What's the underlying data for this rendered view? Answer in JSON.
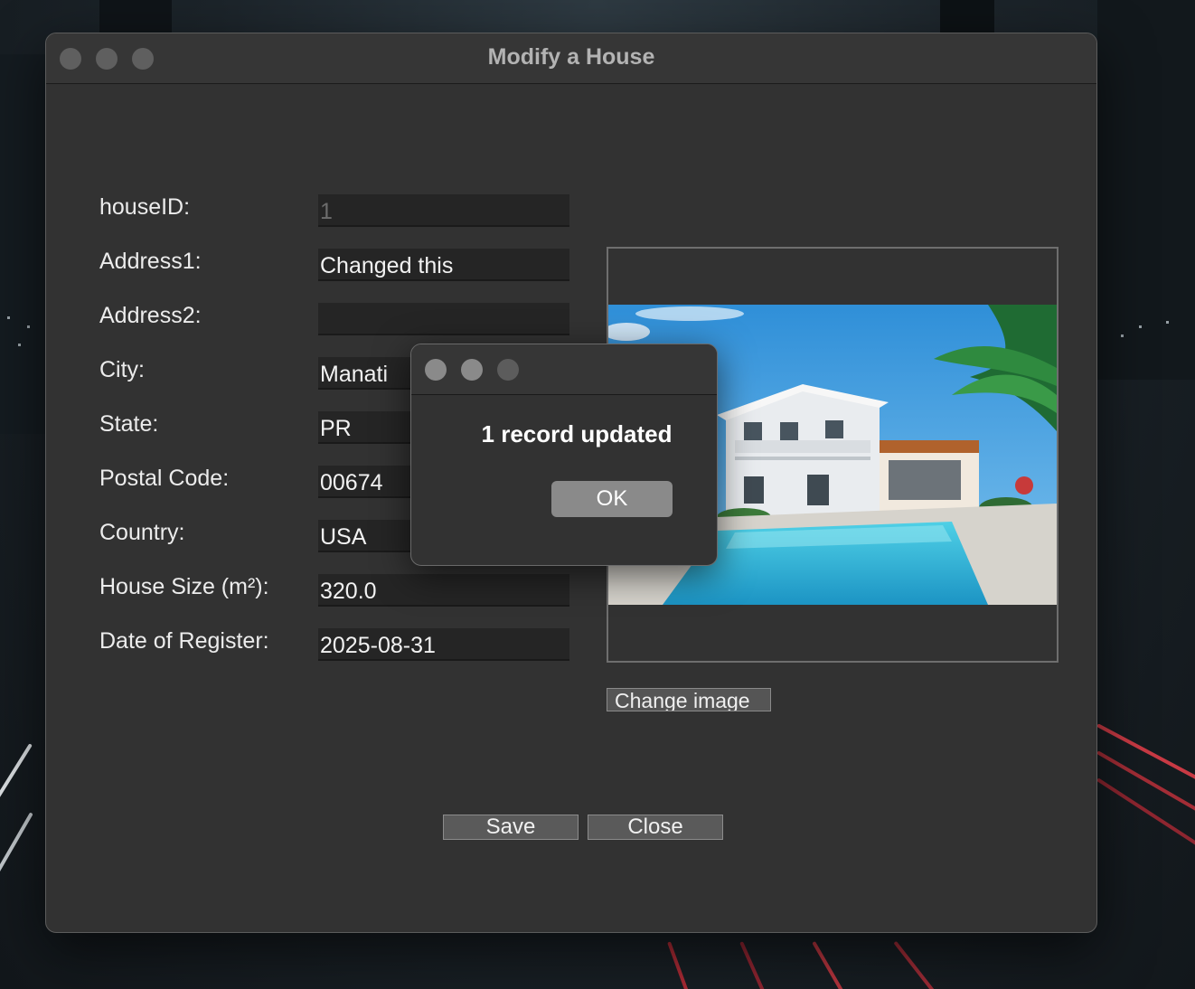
{
  "window": {
    "title": "Modify a House"
  },
  "form": {
    "fields": [
      {
        "label": "houseID:",
        "value": "1"
      },
      {
        "label": "Address1:",
        "value": "Changed this"
      },
      {
        "label": "Address2:",
        "value": ""
      },
      {
        "label": "City:",
        "value": "Manati"
      },
      {
        "label": "State:",
        "value": "PR"
      },
      {
        "label": "Postal Code:",
        "value": "00674"
      },
      {
        "label": "Country:",
        "value": "USA"
      },
      {
        "label": "House Size (m²):",
        "value": "320.0"
      },
      {
        "label": "Date of Register:",
        "value": "2025-08-31"
      }
    ]
  },
  "image_panel": {
    "change_image_label": "Change image"
  },
  "actions": {
    "save_label": "Save",
    "close_label": "Close"
  },
  "dialog": {
    "message": "1 record updated",
    "ok_label": "OK"
  }
}
